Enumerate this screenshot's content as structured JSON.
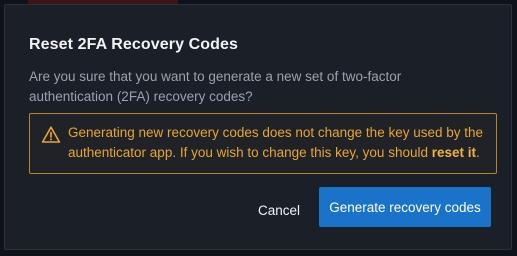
{
  "dialog": {
    "title": "Reset 2FA Recovery Codes",
    "message": "Are you sure that you want to generate a new set of two-factor authentication (2FA) recovery codes?",
    "warning": {
      "icon": "warning-triangle-icon",
      "text_before": "Generating new recovery codes does not change the key used by the authenticator app. If you wish to change this key, you should ",
      "link_text": "reset it",
      "text_after": "."
    },
    "buttons": {
      "cancel_label": "Cancel",
      "primary_label": "Generate recovery codes"
    }
  },
  "colors": {
    "dialog_background": "#1b1f28",
    "warning_accent": "#e5a72e",
    "primary_button": "#1a72c9"
  }
}
